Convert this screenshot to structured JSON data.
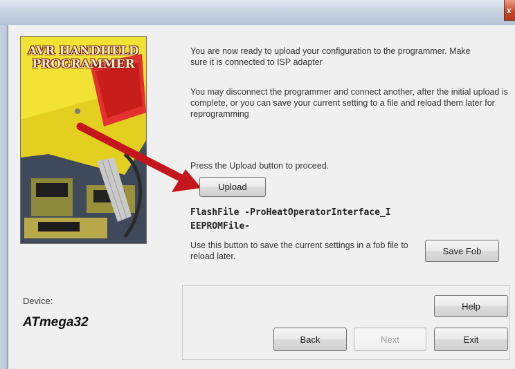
{
  "window": {
    "close_glyph": "x"
  },
  "hero": {
    "title_line1": "AVR HANDHELD",
    "title_line2": "PROGRAMMER"
  },
  "instructions": {
    "para1": "You are now ready to upload your configuration to the programmer. Make sure it is connected to ISP adapter",
    "para2": "You may disconnect the programmer and connect another, after the initial upload is complete, or you can save your current setting to a file and reload them later for reprogramming",
    "prompt": "Press the Upload button to proceed."
  },
  "upload": {
    "label": "Upload"
  },
  "files": {
    "flash": "FlashFile -ProHeatOperatorInterface_I",
    "eeprom": "EEPROMFile-"
  },
  "save_fob": {
    "description": "Use this button to save the current settings in a fob file to reload later.",
    "label": "Save Fob"
  },
  "device": {
    "label": "Device:",
    "value": "ATmega32"
  },
  "nav": {
    "help": "Help",
    "back": "Back",
    "next": "Next",
    "exit": "Exit"
  },
  "colors": {
    "arrow": "#c4161c",
    "accent_yellow": "#f2e234"
  }
}
